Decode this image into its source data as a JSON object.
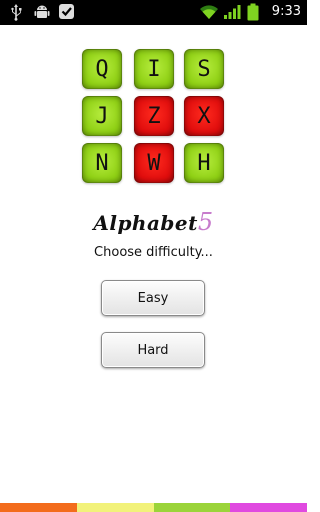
{
  "status_bar": {
    "time": "9:33",
    "icons": [
      "usb-icon",
      "android-debug-icon",
      "download-check-icon",
      "wifi-icon",
      "signal-icon",
      "battery-icon"
    ]
  },
  "tiles": [
    {
      "letter": "Q",
      "color": "green"
    },
    {
      "letter": "I",
      "color": "green"
    },
    {
      "letter": "S",
      "color": "green"
    },
    {
      "letter": "J",
      "color": "green"
    },
    {
      "letter": "Z",
      "color": "red"
    },
    {
      "letter": "X",
      "color": "red"
    },
    {
      "letter": "N",
      "color": "green"
    },
    {
      "letter": "W",
      "color": "red"
    },
    {
      "letter": "H",
      "color": "green"
    }
  ],
  "logo": {
    "word": "Alphabet",
    "digit": "5"
  },
  "subtitle": "Choose difficulty...",
  "buttons": {
    "easy": "Easy",
    "hard": "Hard"
  },
  "colors": {
    "tile_green": "#9ada1e",
    "tile_red": "#e81010",
    "logo_digit": "#c77ccc",
    "bottom_stripes": [
      "#f36c1c",
      "#f2f27a",
      "#9bd43a",
      "#e04ae0"
    ]
  }
}
